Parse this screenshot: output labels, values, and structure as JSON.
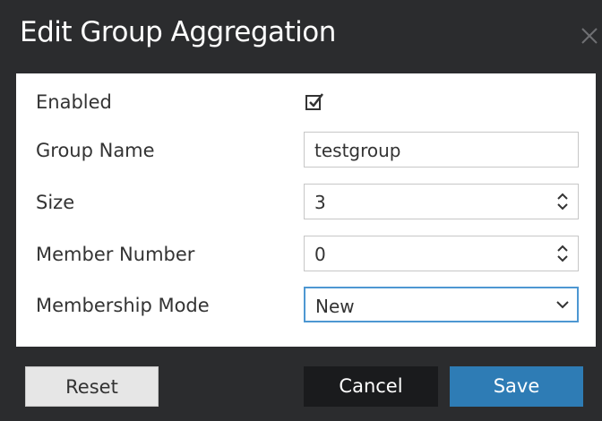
{
  "dialog": {
    "title": "Edit Group Aggregation",
    "close_icon": "close-icon"
  },
  "form": {
    "enabled": {
      "label": "Enabled",
      "checked": true,
      "icon": "checkbox-checked-icon"
    },
    "group_name": {
      "label": "Group Name",
      "value": "testgroup"
    },
    "size": {
      "label": "Size",
      "value": "3",
      "icon": "spinner-arrows-icon"
    },
    "member_number": {
      "label": "Member Number",
      "value": "0",
      "icon": "spinner-arrows-icon"
    },
    "membership_mode": {
      "label": "Membership Mode",
      "value": "New",
      "icon": "chevron-down-icon"
    }
  },
  "footer": {
    "reset_label": "Reset",
    "cancel_label": "Cancel",
    "save_label": "Save"
  },
  "colors": {
    "dialog_chrome": "#2b2c2e",
    "form_background": "#ffffff",
    "save_button": "#2e7cb5",
    "cancel_button": "#1a1b1d",
    "reset_button": "#e6e6e6",
    "focus_border": "#4d97d2"
  }
}
